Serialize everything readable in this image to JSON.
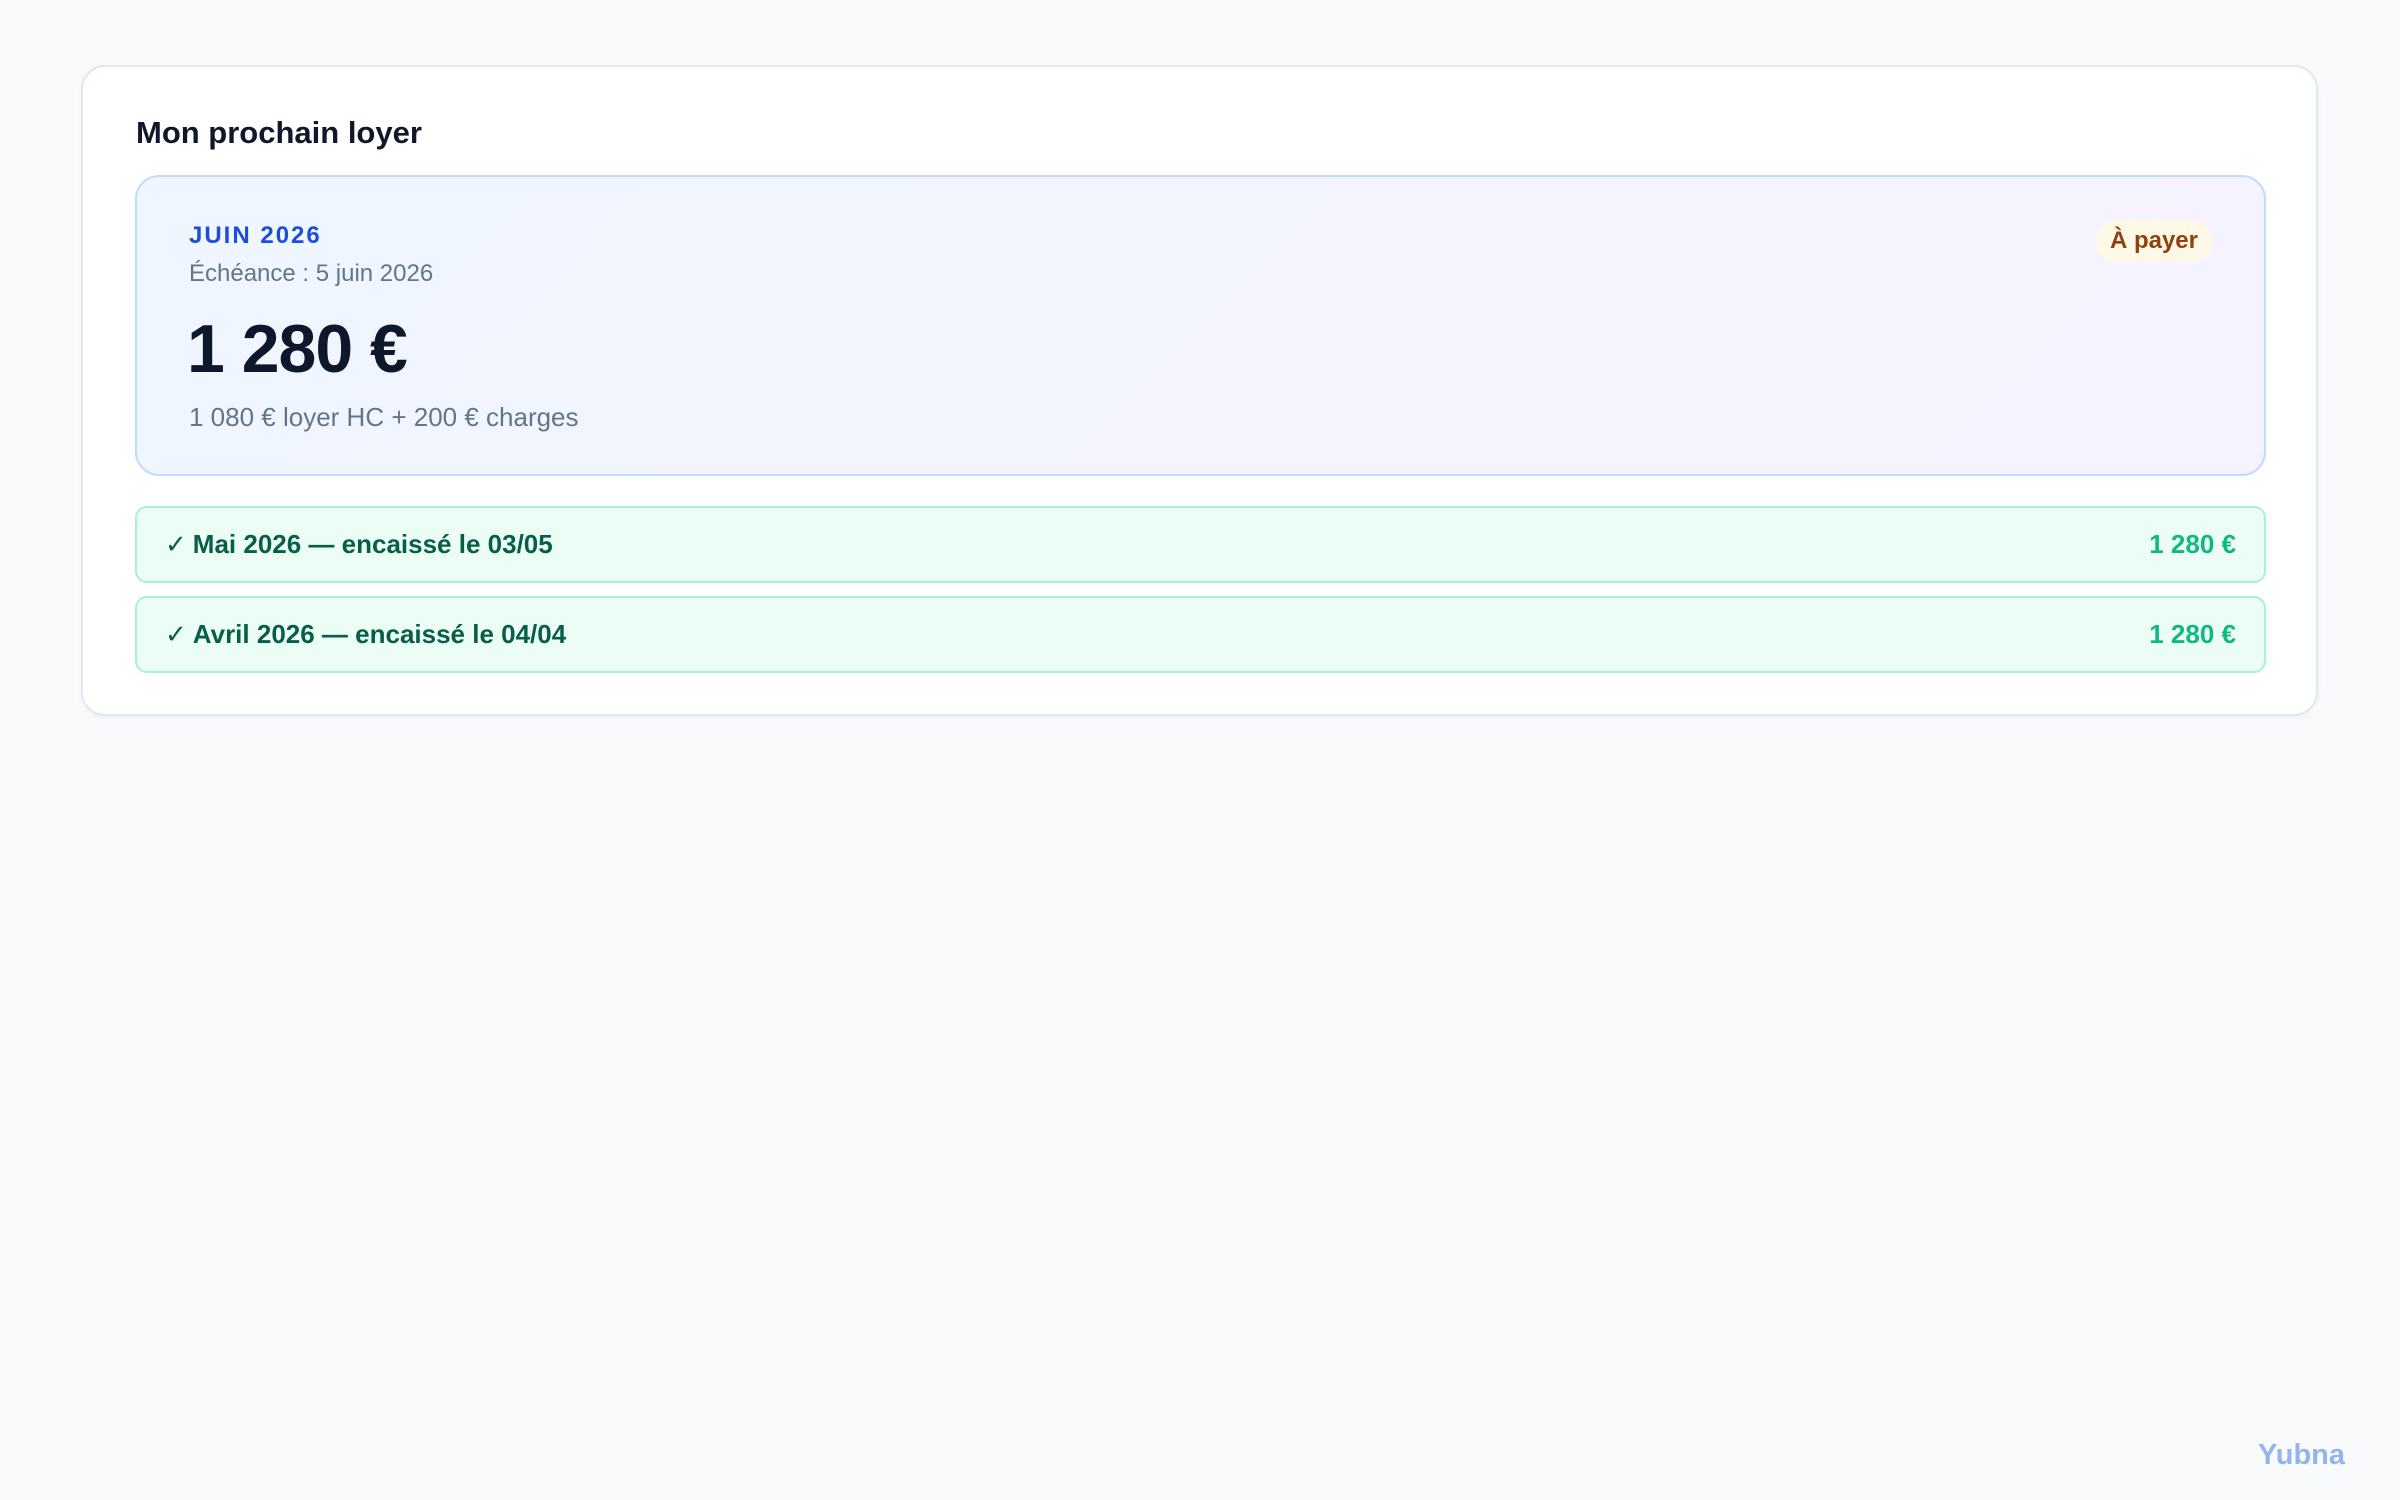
{
  "card": {
    "title": "Mon prochain loyer"
  },
  "next_rent": {
    "period": "JUIN 2026",
    "due_date": "Échéance : 5 juin 2026",
    "amount": "1 280 €",
    "breakdown": "1 080 € loyer HC + 200 € charges",
    "status": "À payer"
  },
  "history": [
    {
      "icon": "check-icon",
      "check": "✓",
      "label": "Mai 2026 — encaissé le 03/05",
      "amount": "1 280 €"
    },
    {
      "icon": "check-icon",
      "check": "✓",
      "label": "Avril 2026 — encaissé le 04/04",
      "amount": "1 280 €"
    }
  ],
  "brand": "Yubna",
  "colors": {
    "period": "#1d4ed8",
    "badge_bg": "#fef9e7",
    "badge_text": "#92400e",
    "paid_bg": "#ecfdf5",
    "paid_border": "#a7f3d0",
    "paid_text": "#065f46",
    "paid_amount": "#10b981",
    "brand": "#93b4ec"
  }
}
